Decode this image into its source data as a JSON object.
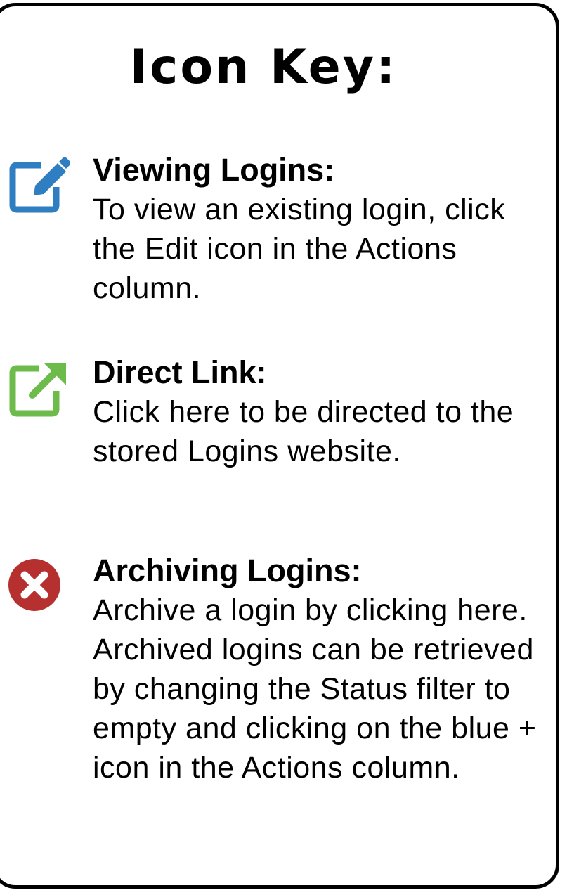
{
  "title": "Icon Key:",
  "entries": [
    {
      "icon": "edit-icon",
      "icon_color": "#2f7ec1",
      "heading": "Viewing Logins:",
      "description": "To view an existing login, click the Edit icon in the Actions column."
    },
    {
      "icon": "external-link-icon",
      "icon_color": "#6cbb4b",
      "heading": "Direct Link:",
      "description": "Click here to be directed to the stored Logins website."
    },
    {
      "icon": "close-circle-icon",
      "icon_color": "#b5302f",
      "heading": "Archiving Logins:",
      "description": "Archive a login by clicking here. Archived logins can be retrieved by changing the Status filter to empty and clicking on the blue + icon in the Actions column."
    }
  ]
}
